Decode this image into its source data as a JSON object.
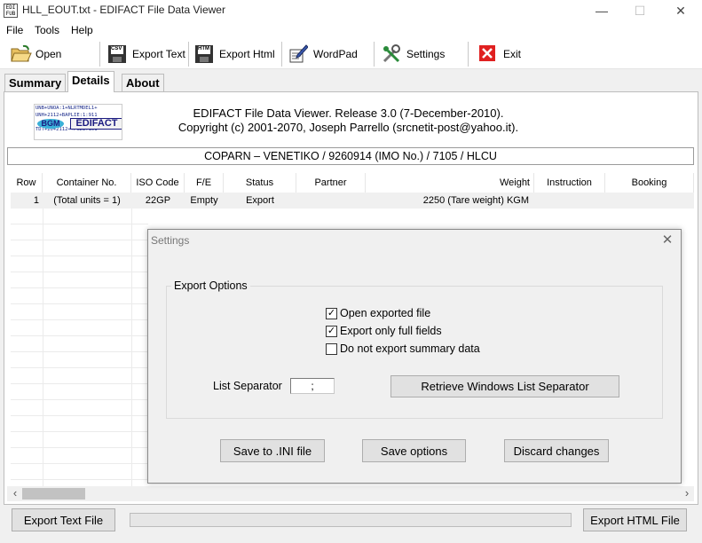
{
  "window": {
    "title": "HLL_EOUT.txt - EDIFACT File Data Viewer",
    "icon_text": "EDI FUB",
    "minimize": "—",
    "maximize": "☐",
    "close": "✕"
  },
  "menu": [
    "File",
    "Tools",
    "Help"
  ],
  "toolbar": {
    "open": "Open",
    "export_text": "Export Text",
    "export_html": "Export Html",
    "wordpad": "WordPad",
    "settings": "Settings",
    "exit": "Exit",
    "csv_badge": "CSV",
    "htm_badge": "HTM"
  },
  "tabs": [
    "Summary",
    "Details",
    "About"
  ],
  "active_tab": "Details",
  "header": {
    "logo_lines": [
      "UNB+UNOA:1+NLRTMDEL1+",
      "UNH+2112+BAPLIE:1:911",
      "",
      "TDT+20+2112++PGDE:101"
    ],
    "logo_bgm": "BGM",
    "logo_edifact": "EDIFACT",
    "release": "EDIFACT File Data Viewer. Release 3.0 (7-December-2010).",
    "copyright": "Copyright (c) 2001-2070, Joseph Parrello (srcnetit-post@yahoo.it).",
    "info": "COPARN – VENETIKO / 9260914 (IMO No.) / 7105 / HLCU"
  },
  "grid": {
    "columns": [
      "Row",
      "Container No.",
      "ISO Code",
      "F/E",
      "Status",
      "Partner",
      "Weight",
      "Instruction",
      "Booking"
    ],
    "rows": [
      [
        "1",
        "(Total units = 1)",
        "22GP",
        "Empty",
        "Export",
        "",
        "2250 (Tare weight) KGM",
        "",
        ""
      ]
    ]
  },
  "bottom": {
    "export_text_file": "Export Text File",
    "export_html_file": "Export HTML File"
  },
  "dialog": {
    "title": "Settings",
    "close": "✕",
    "group_title": "Export Options",
    "options": [
      {
        "label": "Open exported file",
        "checked": true
      },
      {
        "label": "Export only full fields",
        "checked": true
      },
      {
        "label": "Do not export summary data",
        "checked": false
      }
    ],
    "list_separator_label": "List Separator",
    "list_separator_value": ";",
    "retrieve_button": "Retrieve Windows List Separator",
    "save_ini": "Save to .INI file",
    "save_options": "Save options",
    "discard": "Discard changes"
  },
  "scroll": {
    "left": "‹",
    "right": "›"
  },
  "icons": {
    "open": "folder-open-icon",
    "export_text": "csv-disk-icon",
    "export_html": "htm-disk-icon",
    "wordpad": "wordpad-pen-icon",
    "settings": "tools-icon",
    "exit": "exit-x-icon"
  },
  "colors": {
    "exit_red": "#e02020",
    "logo_blue": "#3ab0d8"
  }
}
